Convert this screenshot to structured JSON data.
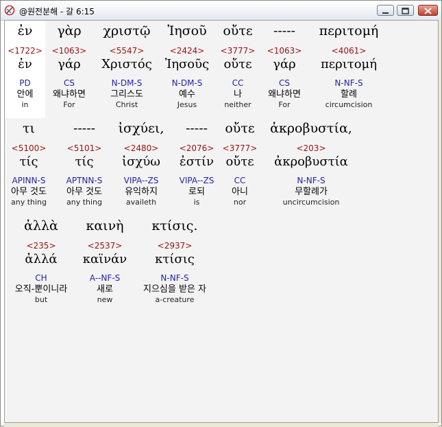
{
  "window": {
    "title": "@원전분해 - 갈 6:15"
  },
  "verse": [
    {
      "greek": "ἐν",
      "strong": "<1722>",
      "lemma": "ἐν",
      "parse": "PD",
      "korean": "안에",
      "english": "in"
    },
    {
      "greek": "γὰρ",
      "strong": "<1063>",
      "lemma": "γάρ",
      "parse": "CS",
      "korean": "왜냐하면",
      "english": "For"
    },
    {
      "greek": "χριστῷ",
      "strong": "<5547>",
      "lemma": "Χριστός",
      "parse": "N-DM-S",
      "korean": "그리스도",
      "english": "Christ"
    },
    {
      "greek": "Ἰησοῦ",
      "strong": "<2424>",
      "lemma": "Ἰησοῦς",
      "parse": "N-DM-S",
      "korean": "예수",
      "english": "Jesus"
    },
    {
      "greek": "οὔτε",
      "strong": "<3777>",
      "lemma": "οὔτε",
      "parse": "CC",
      "korean": "나",
      "english": "neither"
    },
    {
      "greek": "-----",
      "strong": "<1063>",
      "lemma": "γάρ",
      "parse": "CS",
      "korean": "왜냐하면",
      "english": "For"
    },
    {
      "greek": "περιτομή",
      "strong": "<4061>",
      "lemma": "περιτομή",
      "parse": "N-NF-S",
      "korean": "할례",
      "english": "circumcision"
    },
    {
      "greek": "τι",
      "strong": "<5100>",
      "lemma": "τίς",
      "parse": "APINN-S",
      "korean": "아무 것도",
      "english": "any thing"
    },
    {
      "greek": "-----",
      "strong": "<5101>",
      "lemma": "τίς",
      "parse": "APTNN-S",
      "korean": "아무 것도",
      "english": "any thing"
    },
    {
      "greek": "ἰσχύει,",
      "strong": "<2480>",
      "lemma": "ἰσχύω",
      "parse": "VIPA--ZS",
      "korean": "유익하지",
      "english": "availeth"
    },
    {
      "greek": "-----",
      "strong": "<2076>",
      "lemma": "ἐστίν",
      "parse": "VIPA--ZS",
      "korean": "로되",
      "english": "is"
    },
    {
      "greek": "οὔτε",
      "strong": "<3777>",
      "lemma": "οὔτε",
      "parse": "CC",
      "korean": "아니",
      "english": "nor"
    },
    {
      "greek": "ἀκροβυστία,",
      "strong": "<203>",
      "lemma": "ἀκροβυστία",
      "parse": "N-NF-S",
      "korean": "무할례가",
      "english": "uncircumcision"
    },
    {
      "greek": "ἀλλὰ",
      "strong": "<235>",
      "lemma": "ἀλλά",
      "parse": "CH",
      "korean": "오직-뿐이니라",
      "english": "but"
    },
    {
      "greek": "καινὴ",
      "strong": "<2537>",
      "lemma": "καϊνάν",
      "parse": "A--NF-S",
      "korean": "새로",
      "english": "new"
    },
    {
      "greek": "κτίσις.",
      "strong": "<2937>",
      "lemma": "κτίσις",
      "parse": "N-NF-S",
      "korean": "지으심을 받은 자",
      "english": "a-creature"
    }
  ]
}
